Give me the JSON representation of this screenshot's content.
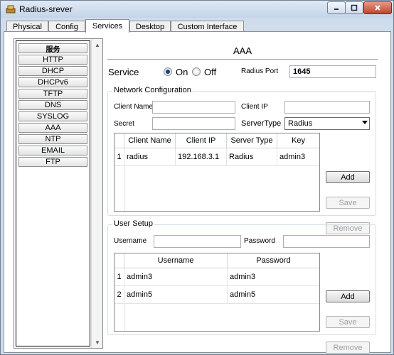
{
  "window": {
    "title": "Radius-srever"
  },
  "tabs": [
    "Physical",
    "Config",
    "Services",
    "Desktop",
    "Custom Interface"
  ],
  "sidebar": {
    "items": [
      "服务",
      "HTTP",
      "DHCP",
      "DHCPv6",
      "TFTP",
      "DNS",
      "SYSLOG",
      "AAA",
      "NTP",
      "EMAIL",
      "FTP"
    ]
  },
  "pane": {
    "title": "AAA",
    "service_label": "Service",
    "on_label": "On",
    "off_label": "Off",
    "service_state": "On",
    "radius_port_label": "Radius Port",
    "radius_port_value": "1645"
  },
  "network": {
    "legend": "Network Configuration",
    "client_name_label": "Client Name",
    "client_ip_label": "Client IP",
    "secret_label": "Secret",
    "servertype_label": "ServerType",
    "servertype_value": "Radius",
    "columns": [
      "Client Name",
      "Client IP",
      "Server Type",
      "Key"
    ],
    "rows": [
      {
        "num": "1",
        "client_name": "radius",
        "client_ip": "192.168.3.1",
        "server_type": "Radius",
        "key": "admin3"
      }
    ],
    "add_label": "Add",
    "save_label": "Save",
    "remove_label": "Remove"
  },
  "user_setup": {
    "legend": "User Setup",
    "username_label": "Username",
    "password_label": "Password",
    "columns": [
      "Username",
      "Password"
    ],
    "rows": [
      {
        "num": "1",
        "username": "admin3",
        "password": "admin3"
      },
      {
        "num": "2",
        "username": "admin5",
        "password": "admin5"
      }
    ],
    "add_label": "Add",
    "save_label": "Save",
    "remove_label": "Remove"
  },
  "colors": {
    "accent": "#1a3d8a",
    "window_frame": "#cfdcec"
  }
}
